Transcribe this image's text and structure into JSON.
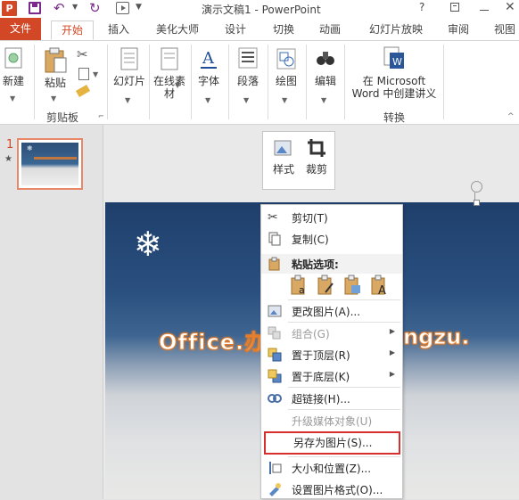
{
  "window": {
    "app_icon": "P",
    "title": "演示文稿1 - PowerPoint",
    "help": "?"
  },
  "quick_access": {
    "icons": [
      "powerpoint-logo-icon",
      "save-icon",
      "undo-icon",
      "redo-icon",
      "start-slideshow-icon",
      "customize-icon"
    ]
  },
  "tabs": [
    {
      "label": "文件"
    },
    {
      "label": "开始"
    },
    {
      "label": "插入"
    },
    {
      "label": "美化大师"
    },
    {
      "label": "设计"
    },
    {
      "label": "切换"
    },
    {
      "label": "动画"
    },
    {
      "label": "幻灯片放映"
    },
    {
      "label": "审阅"
    },
    {
      "label": "视图"
    }
  ],
  "ribbon": {
    "new_label": "新建",
    "paste_label": "粘贴",
    "clipboard_group": "剪贴板",
    "slides_label": "幻灯片",
    "online_material_label_1": "在线素",
    "online_material_label_2": "材",
    "font_label": "字体",
    "paragraph_label": "段落",
    "drawing_label": "绘图",
    "editing_label": "编辑",
    "word_line1": "在 Microsoft",
    "word_line2": "Word 中创建讲义",
    "convert_group": "转换"
  },
  "slides": {
    "number": "1",
    "star": "★"
  },
  "mini_toolbar": {
    "style_label": "样式",
    "crop_label": "裁剪"
  },
  "slide_content": {
    "text_left": "Office.办",
    "text_right": "ngzu."
  },
  "context_menu": {
    "cut": "剪切(T)",
    "copy": "复制(C)",
    "paste_options": "粘贴选项:",
    "change_picture": "更改图片(A)...",
    "group": "组合(G)",
    "bring_to_front": "置于顶层(R)",
    "send_to_back": "置于底层(K)",
    "hyperlink": "超链接(H)...",
    "upgrade_media": "升级媒体对象(U)",
    "save_as_picture": "另存为图片(S)...",
    "size_position": "大小和位置(Z)...",
    "format_picture": "设置图片格式(O)..."
  },
  "colors": {
    "accent": "#d24726",
    "highlight_border": "#d72e2e"
  }
}
